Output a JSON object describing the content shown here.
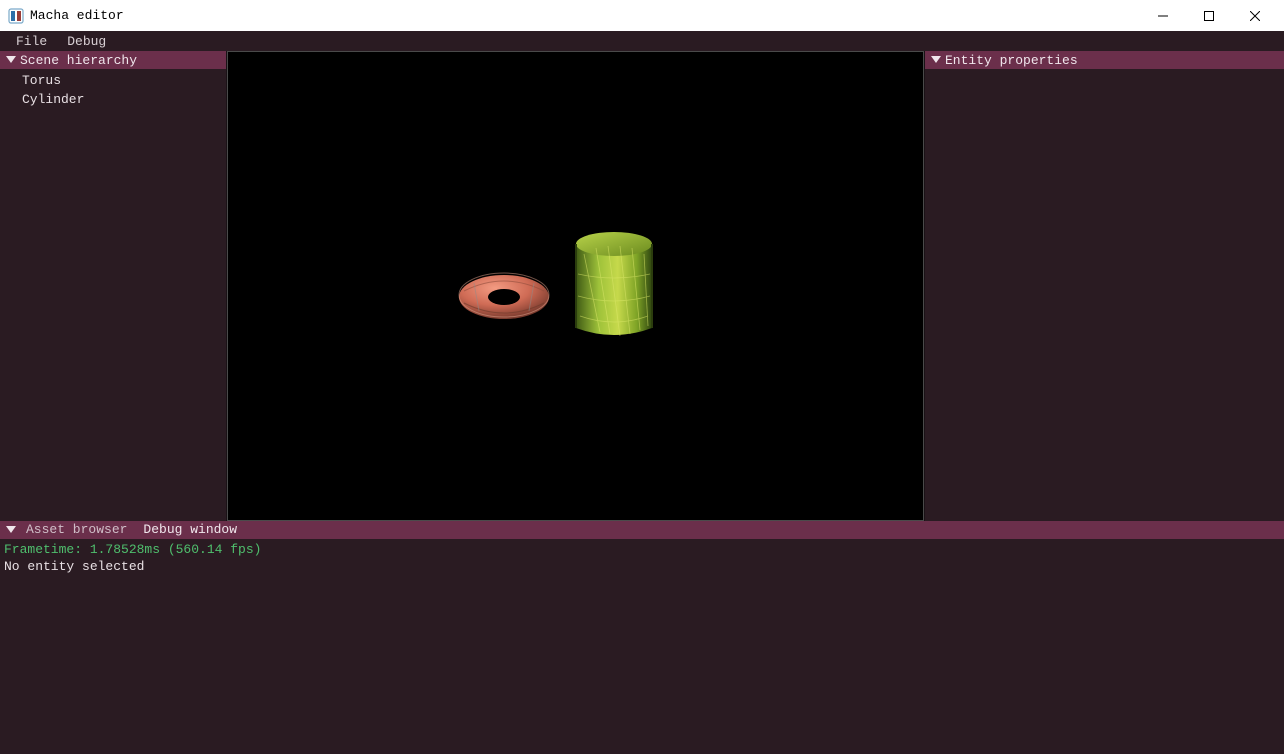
{
  "window": {
    "title": "Macha editor"
  },
  "menubar": {
    "items": [
      "File",
      "Debug"
    ]
  },
  "panels": {
    "scene_hierarchy": {
      "title": "Scene hierarchy",
      "items": [
        "Torus",
        "Cylinder"
      ]
    },
    "entity_properties": {
      "title": "Entity properties"
    }
  },
  "bottom": {
    "tabs": [
      "Asset browser",
      "Debug window"
    ],
    "active_tab": "Debug window",
    "frametime_line": "Frametime: 1.78528ms (560.14 fps)",
    "status_line": "No entity selected"
  }
}
